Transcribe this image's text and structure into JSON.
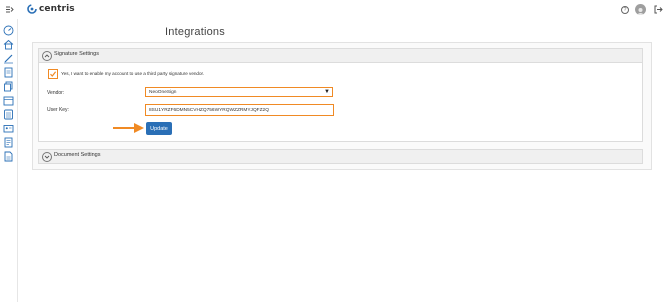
{
  "app": {
    "brand": "centris"
  },
  "colors": {
    "accent": "#2a6fb6",
    "highlight": "#f08a24"
  },
  "topbar": {
    "menu_icon": "collapse-menu-icon",
    "help_icon": "help-icon",
    "avatar_icon": "user-avatar",
    "logout_icon": "logout-icon"
  },
  "sidebar": {
    "items": [
      {
        "icon": "dashboard-icon"
      },
      {
        "icon": "home-icon"
      },
      {
        "icon": "edit-icon"
      },
      {
        "icon": "document-icon"
      },
      {
        "icon": "files-icon"
      },
      {
        "icon": "calendar-icon"
      },
      {
        "icon": "list-icon"
      },
      {
        "icon": "id-card-icon"
      },
      {
        "icon": "notes-icon"
      },
      {
        "icon": "report-icon"
      }
    ]
  },
  "page": {
    "title": "Integrations"
  },
  "signature_settings": {
    "title": "Signature Settings",
    "consent_label": "Yes, I want to enable my account to use a third party signature vendor.",
    "consent_checked": true,
    "vendor_label": "Vendor:",
    "vendor_value": "NeoOneSign",
    "user_key_label": "User Key:",
    "user_key_value": "8SU1YRZF6DMN5CVHZQ756WYRQWZZRMYJQFZ2Q",
    "update_label": "Update"
  },
  "document_settings": {
    "title": "Document Settings"
  }
}
